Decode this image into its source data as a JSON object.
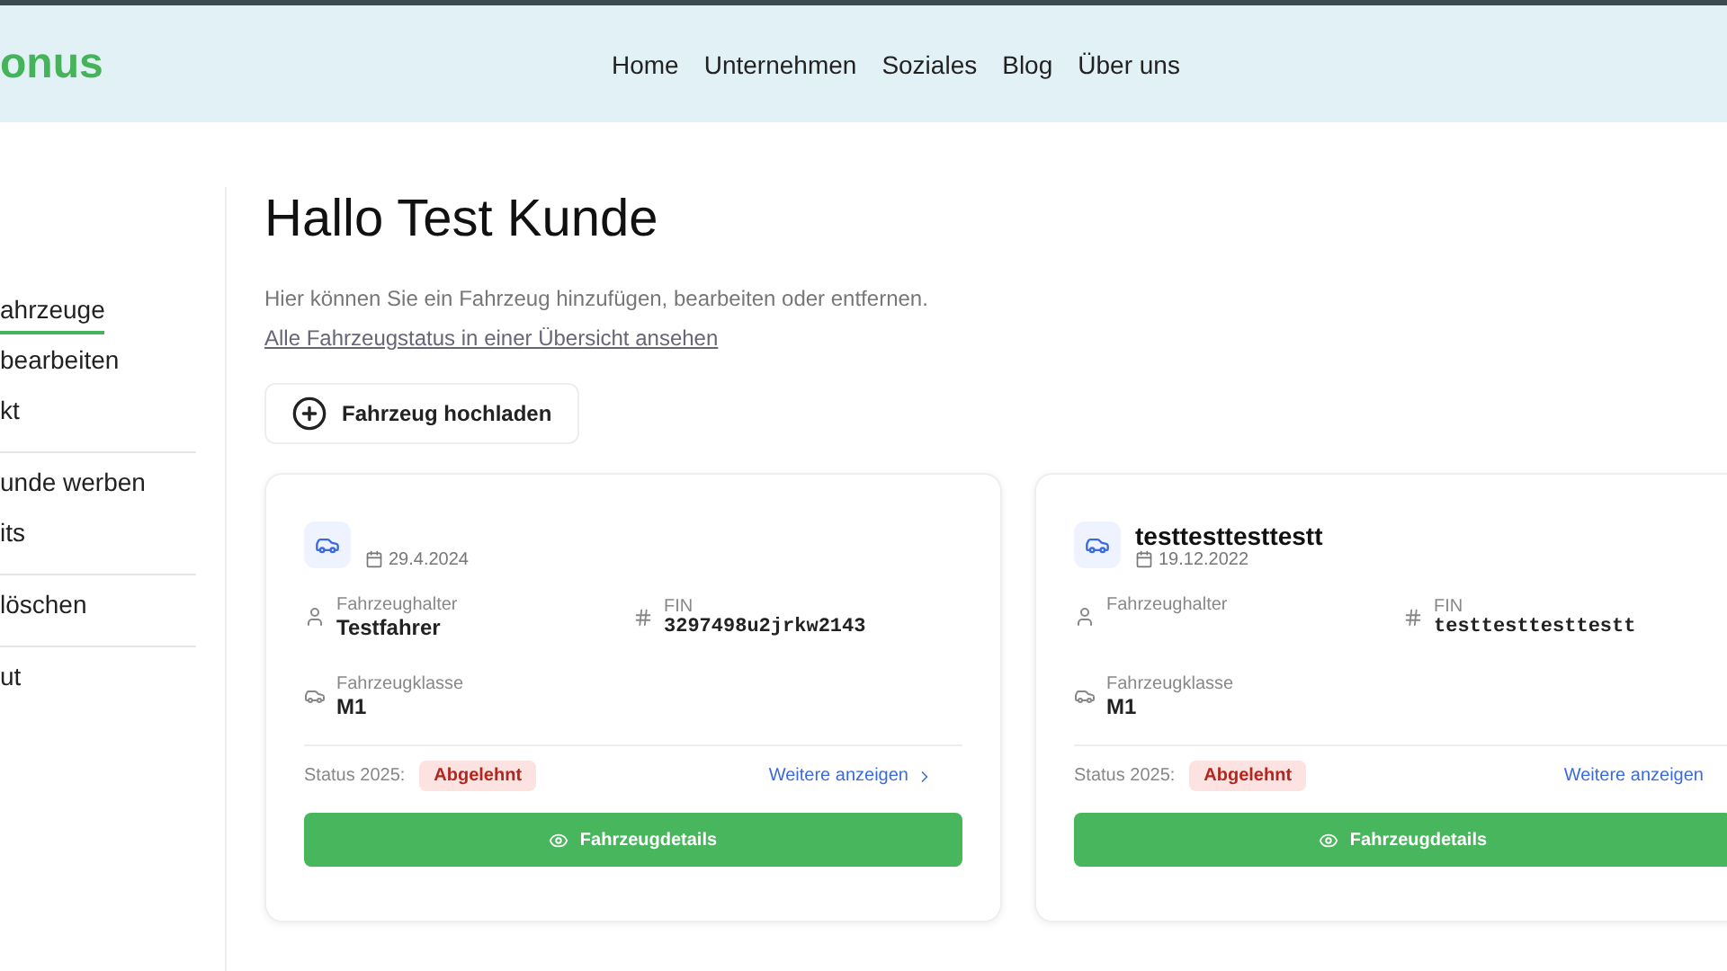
{
  "header": {
    "logo": "onus",
    "nav": [
      "Home",
      "Unternehmen",
      "Soziales",
      "Blog",
      "Über uns"
    ]
  },
  "sidebar": {
    "groups": [
      [
        {
          "label": "ahrzeuge",
          "selected": true
        },
        {
          "label": "bearbeiten",
          "selected": false
        },
        {
          "label": "kt",
          "selected": false
        }
      ],
      [
        {
          "label": "unde werben",
          "selected": false
        },
        {
          "label": "its",
          "selected": false
        }
      ],
      [
        {
          "label": "löschen",
          "selected": false
        }
      ],
      [
        {
          "label": "ut",
          "selected": false
        }
      ]
    ]
  },
  "main": {
    "title": "Hallo Test Kunde",
    "intro": "Hier können Sie ein Fahrzeug hinzufügen, bearbeiten oder entfernen.",
    "overview_link": "Alle Fahrzeugstatus in einer Übersicht ansehen",
    "upload_button": "Fahrzeug hochladen",
    "vehicles": [
      {
        "date": "29.4.2024",
        "holder_label": "Fahrzeughalter",
        "holder": "Testfahrer",
        "fin_label": "FIN",
        "fin": "3297498u2jrkw2143",
        "class_label": "Fahrzeugklasse",
        "class": "M1",
        "status_label": "Status 2025:",
        "status": "Abgelehnt",
        "more": "Weitere anzeigen",
        "details_button": "Fahrzeugdetails"
      },
      {
        "name": "testtesttesttestt",
        "date": "19.12.2022",
        "holder_label": "Fahrzeughalter",
        "fin_label": "FIN",
        "fin": "testtesttesttestt",
        "class_label": "Fahrzeugklasse",
        "class": "M1",
        "status_label": "Status 2025:",
        "status": "Abgelehnt",
        "more": "Weitere anzeigen",
        "details_button": "Fahrzeugdetails"
      }
    ]
  }
}
